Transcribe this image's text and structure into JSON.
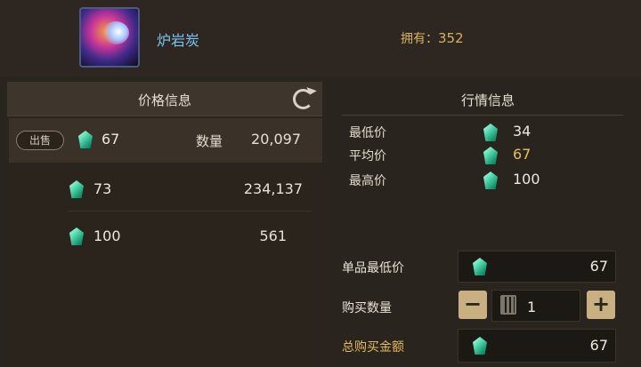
{
  "item": {
    "name": "炉岩炭",
    "owned_label": "拥有：",
    "owned_count": "352"
  },
  "left_panel": {
    "title": "价格信息",
    "sell_label": "出售",
    "qty_label": "数量",
    "listings": [
      {
        "price": "67",
        "quantity": "20,097"
      },
      {
        "price": "73",
        "quantity": "234,137"
      },
      {
        "price": "100",
        "quantity": "561"
      }
    ]
  },
  "right_panel": {
    "title": "行情信息",
    "stats": [
      {
        "label": "最低价",
        "value": "34"
      },
      {
        "label": "平均价",
        "value": "67"
      },
      {
        "label": "最高价",
        "value": "100"
      }
    ],
    "unit_min_label": "单品最低价",
    "unit_min_value": "67",
    "buy_qty_label": "购买数量",
    "buy_qty_value": "1",
    "minus": "−",
    "plus": "+",
    "total_label": "总购买金额",
    "total_value": "67"
  },
  "colors": {
    "accent_gold": "#e2c05c",
    "item_name": "#79c3ef",
    "gem": "#3ed3a3"
  }
}
